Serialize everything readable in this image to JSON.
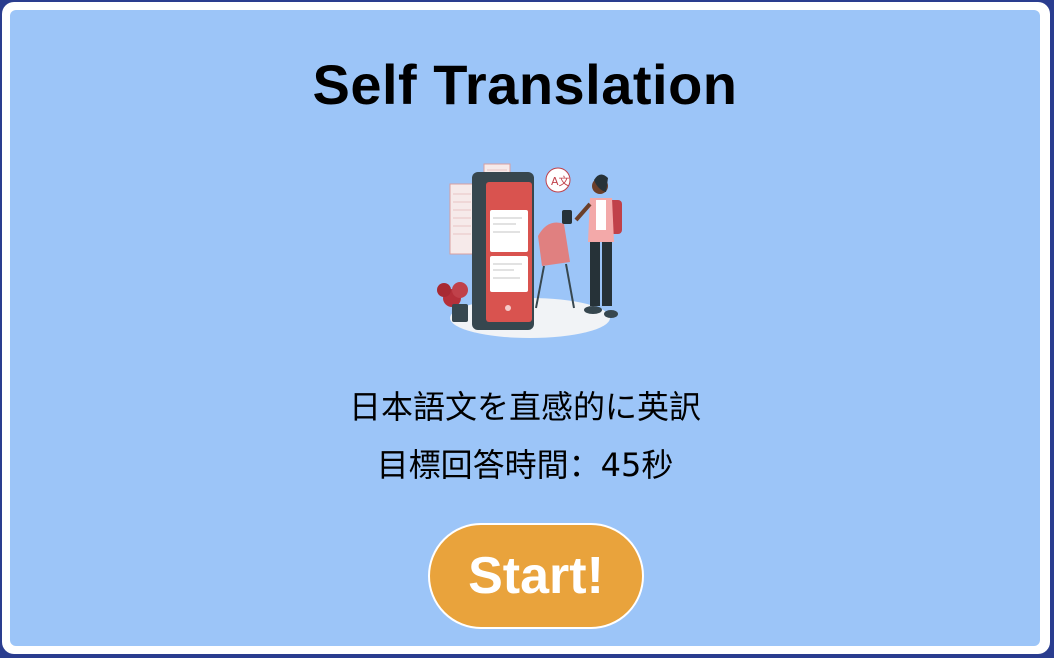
{
  "page": {
    "title": "Self Translation",
    "description_line1": "日本語文を直感的に英訳",
    "description_line2": "目標回答時間：45秒",
    "start_button_label": "Start!",
    "illustration": {
      "icon": "translation-app-illustration",
      "bubble_text": "A文"
    }
  },
  "colors": {
    "page_border": "#2a3d8f",
    "card_background": "#9cc5f8",
    "button_background": "#e9a33c",
    "button_text": "#ffffff",
    "accent_red": "#d9534f"
  }
}
